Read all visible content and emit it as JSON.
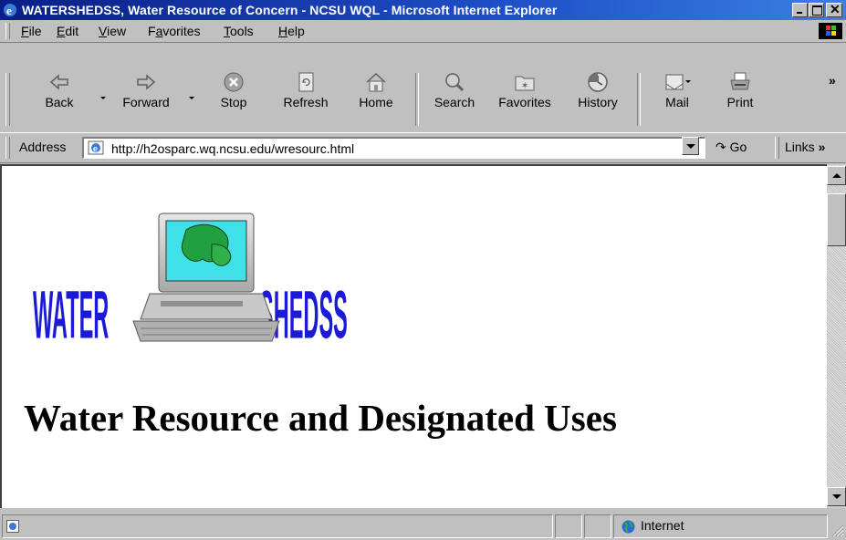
{
  "window": {
    "title": "WATERSHEDSS, Water Resource of Concern - NCSU WQL - Microsoft Internet Explorer"
  },
  "menu": {
    "items": [
      {
        "label": "File",
        "accel": "F",
        "rest": "ile"
      },
      {
        "label": "Edit",
        "accel": "E",
        "rest": "dit"
      },
      {
        "label": "View",
        "accel": "V",
        "rest": "iew"
      },
      {
        "label": "Favorites",
        "accel": "a",
        "pre": "F",
        "rest": "vorites"
      },
      {
        "label": "Tools",
        "accel": "T",
        "rest": "ools"
      },
      {
        "label": "Help",
        "accel": "H",
        "rest": "elp"
      }
    ]
  },
  "toolbar": {
    "back": "Back",
    "forward": "Forward",
    "stop": "Stop",
    "refresh": "Refresh",
    "home": "Home",
    "search": "Search",
    "favorites": "Favorites",
    "history": "History",
    "mail": "Mail",
    "print": "Print",
    "chevron": "»"
  },
  "address": {
    "label": "Address",
    "url": "http://h2osparc.wq.ncsu.edu/wresourc.html",
    "go": "Go",
    "links": "Links",
    "links_chevron": "»"
  },
  "page": {
    "logo_text_left": "WATER",
    "logo_text_right": "SHEDSS",
    "heading": "Water Resource and Designated Uses"
  },
  "status": {
    "zone": "Internet"
  },
  "colors": {
    "title_start": "#0a1e86",
    "title_end": "#3a80e0",
    "logo_blue": "#1a1ad8",
    "chrome": "#c0c0c0"
  }
}
